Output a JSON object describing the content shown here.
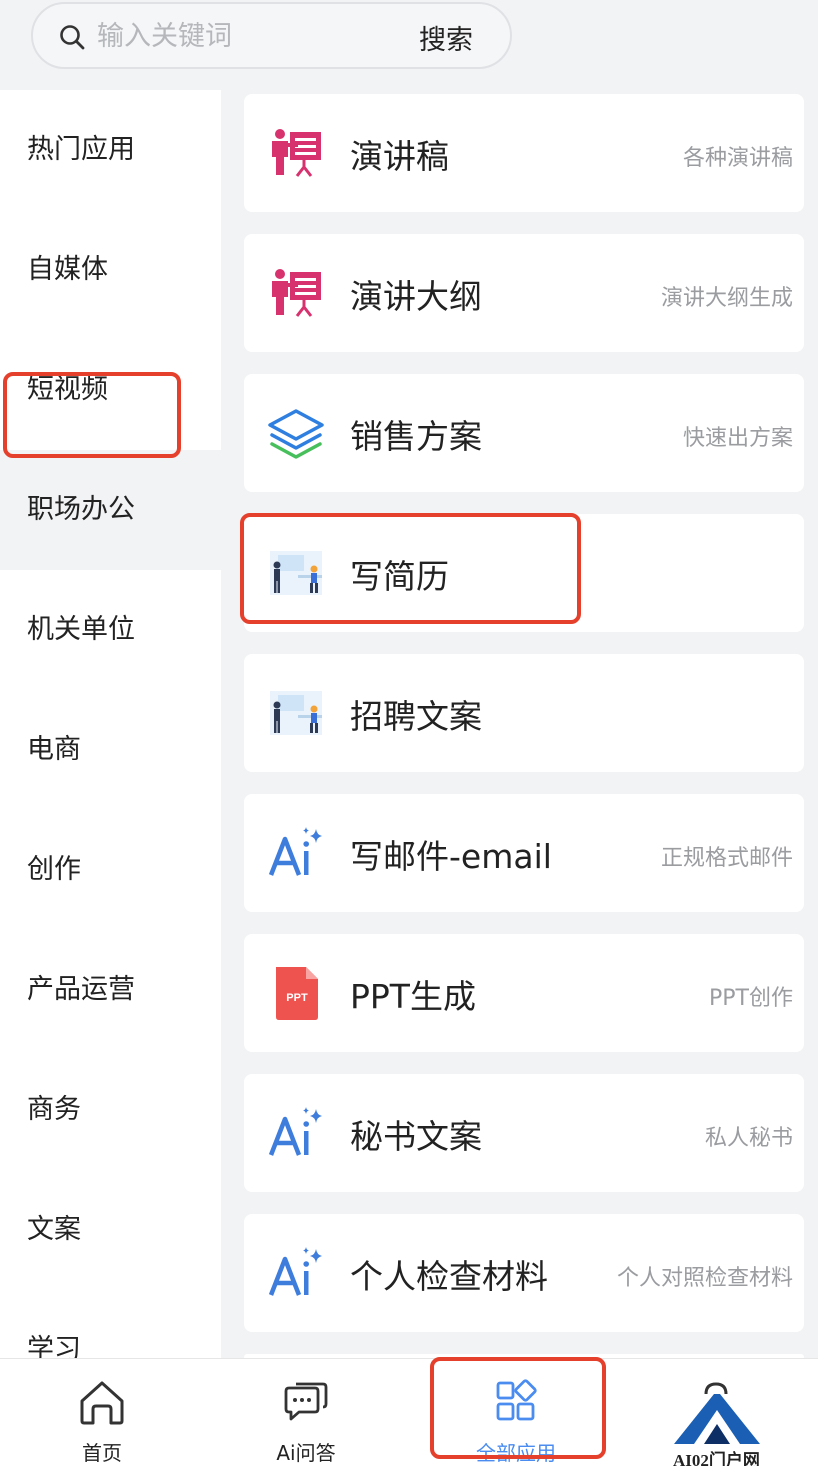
{
  "search": {
    "placeholder": "输入关键词",
    "button": "搜索"
  },
  "sidebar": {
    "active": "职场办公",
    "items": [
      {
        "label": "热门应用"
      },
      {
        "label": "自媒体"
      },
      {
        "label": "短视频"
      },
      {
        "label": "职场办公"
      },
      {
        "label": "机关单位"
      },
      {
        "label": "电商"
      },
      {
        "label": "创作"
      },
      {
        "label": "产品运营"
      },
      {
        "label": "商务"
      },
      {
        "label": "文案"
      },
      {
        "label": "学习"
      }
    ]
  },
  "apps": [
    {
      "title": "演讲稿",
      "desc": "各种演讲稿",
      "icon": "presentation-icon"
    },
    {
      "title": "演讲大纲",
      "desc": "演讲大纲生成",
      "icon": "presentation-icon"
    },
    {
      "title": "销售方案",
      "desc": "快速出方案",
      "icon": "layers-icon"
    },
    {
      "title": "写简历",
      "desc": "",
      "icon": "office-scene-icon"
    },
    {
      "title": "招聘文案",
      "desc": "",
      "icon": "office-scene-icon"
    },
    {
      "title": "写邮件-email",
      "desc": "正规格式邮件",
      "icon": "ai-sparkle-icon"
    },
    {
      "title": "PPT生成",
      "desc": "PPT创作",
      "icon": "ppt-file-icon",
      "icon_text": "PPT"
    },
    {
      "title": "秘书文案",
      "desc": "私人秘书",
      "icon": "ai-sparkle-icon"
    },
    {
      "title": "个人检查材料",
      "desc": "个人对照检查材料",
      "icon": "ai-sparkle-icon"
    }
  ],
  "nav": {
    "active": "全部应用",
    "items": [
      {
        "label": "首页",
        "icon": "home-icon"
      },
      {
        "label": "Ai问答",
        "icon": "chat-icon"
      },
      {
        "label": "全部应用",
        "icon": "apps-grid-icon"
      }
    ]
  },
  "watermark": {
    "text": "AI02门户网"
  },
  "colors": {
    "accent": "#4a8cf0",
    "highlight": "#e5402c",
    "ai_blue": "#3f7ddd",
    "presentation_pink": "#d8326e",
    "ppt_red": "#ef5350"
  }
}
